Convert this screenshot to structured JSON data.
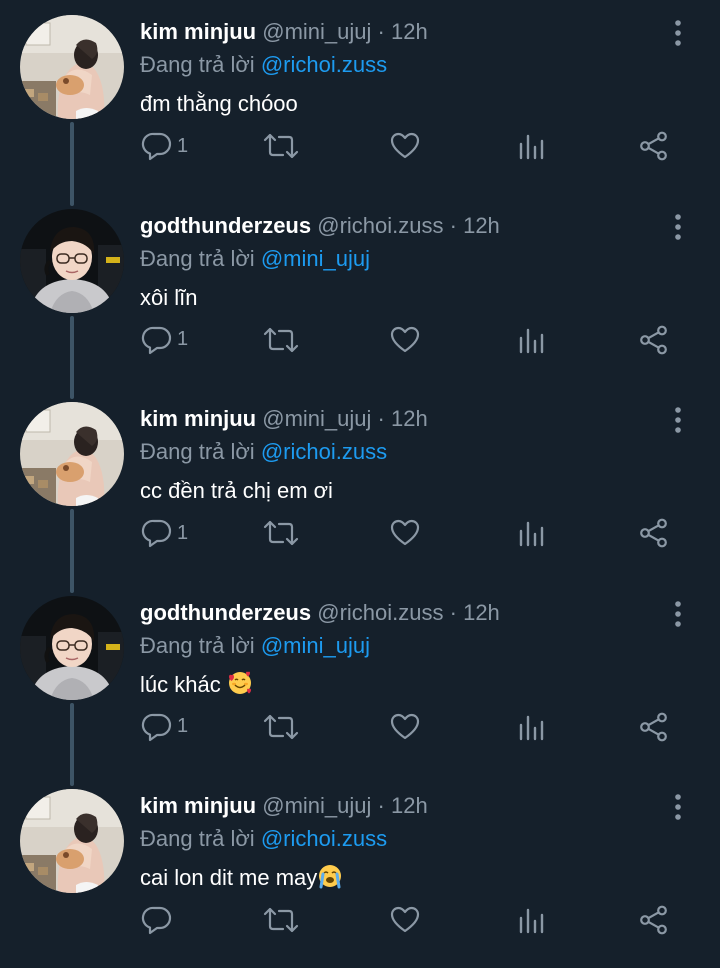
{
  "reply_prefix": "Đang trả lời",
  "colors": {
    "background": "#15202b",
    "text_primary": "#ffffff",
    "text_secondary": "#8b98a5",
    "link": "#1d9bf0",
    "thread_line": "#3d5466"
  },
  "tweets": [
    {
      "display_name": "kim minjuu",
      "handle": "@mini_ujuj",
      "separator": "·",
      "time": "12h",
      "reply_to": "@richoi.zuss",
      "text": "đm thằng chóoo",
      "reply_count": "1",
      "avatar": "minjuu-avatar"
    },
    {
      "display_name": "godthunderzeus",
      "handle": "@richoi.zuss",
      "separator": "·",
      "time": "12h",
      "reply_to": "@mini_ujuj",
      "text": "xôi lĩn",
      "reply_count": "1",
      "avatar": "zeus-avatar"
    },
    {
      "display_name": "kim minjuu",
      "handle": "@mini_ujuj",
      "separator": "·",
      "time": "12h",
      "reply_to": "@richoi.zuss",
      "text": "cc đền trả chị em ơi",
      "reply_count": "1",
      "avatar": "minjuu-avatar"
    },
    {
      "display_name": "godthunderzeus",
      "handle": "@richoi.zuss",
      "separator": "·",
      "time": "12h",
      "reply_to": "@mini_ujuj",
      "text": "lúc khác ",
      "emoji": "smiling-face-with-hearts-emoji",
      "reply_count": "1",
      "avatar": "zeus-avatar"
    },
    {
      "display_name": "kim minjuu",
      "handle": "@mini_ujuj",
      "separator": "·",
      "time": "12h",
      "reply_to": "@richoi.zuss",
      "text": "cai lon dit me may",
      "emoji": "loudly-crying-face-emoji",
      "reply_count": "",
      "avatar": "minjuu-avatar"
    }
  ],
  "icons": {
    "more": "more-vertical-icon",
    "reply": "reply-icon",
    "retweet": "retweet-icon",
    "like": "like-icon",
    "views": "views-icon",
    "share": "share-icon"
  }
}
